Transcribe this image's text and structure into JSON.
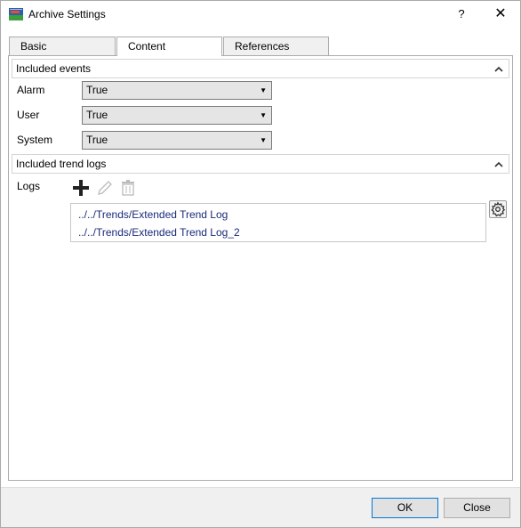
{
  "window": {
    "title": "Archive Settings",
    "help_label": "?",
    "close_label": "✕"
  },
  "tabs": [
    {
      "label": "Basic",
      "active": false
    },
    {
      "label": "Content",
      "active": true
    },
    {
      "label": "References",
      "active": false
    }
  ],
  "included_events": {
    "header": "Included events",
    "fields": [
      {
        "label": "Alarm",
        "value": "True"
      },
      {
        "label": "User",
        "value": "True"
      },
      {
        "label": "System",
        "value": "True"
      }
    ]
  },
  "included_trend_logs": {
    "header": "Included trend logs",
    "logs_label": "Logs",
    "logs": [
      "../../Trends/Extended Trend Log",
      "../../Trends/Extended Trend Log_2"
    ]
  },
  "footer": {
    "ok_label": "OK",
    "close_label": "Close"
  },
  "colors": {
    "accent": "#0078d7",
    "link": "#1a2a7a"
  }
}
